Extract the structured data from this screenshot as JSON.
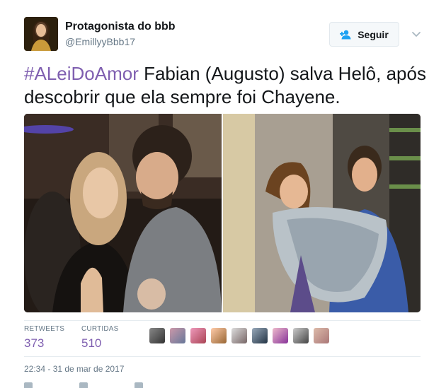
{
  "author": {
    "display_name": "Protagonista do bbb",
    "handle": "@EmillyyBbb17"
  },
  "follow_button": {
    "label": "Seguir",
    "icon": "add-user-icon"
  },
  "tweet": {
    "hashtag": "#ALeiDoAmor",
    "text": " Fabian (Augusto) salva Helô, após descobrir que ela sempre foi Chayene."
  },
  "stats": {
    "retweets_label": "RETWEETS",
    "retweets_value": "373",
    "likes_label": "CURTIDAS",
    "likes_value": "510"
  },
  "timestamp": "22:34 - 31 de mar de 2017",
  "colors": {
    "hashtag": "#7f5fb0",
    "muted": "#657786",
    "border": "#e6ecf0"
  }
}
